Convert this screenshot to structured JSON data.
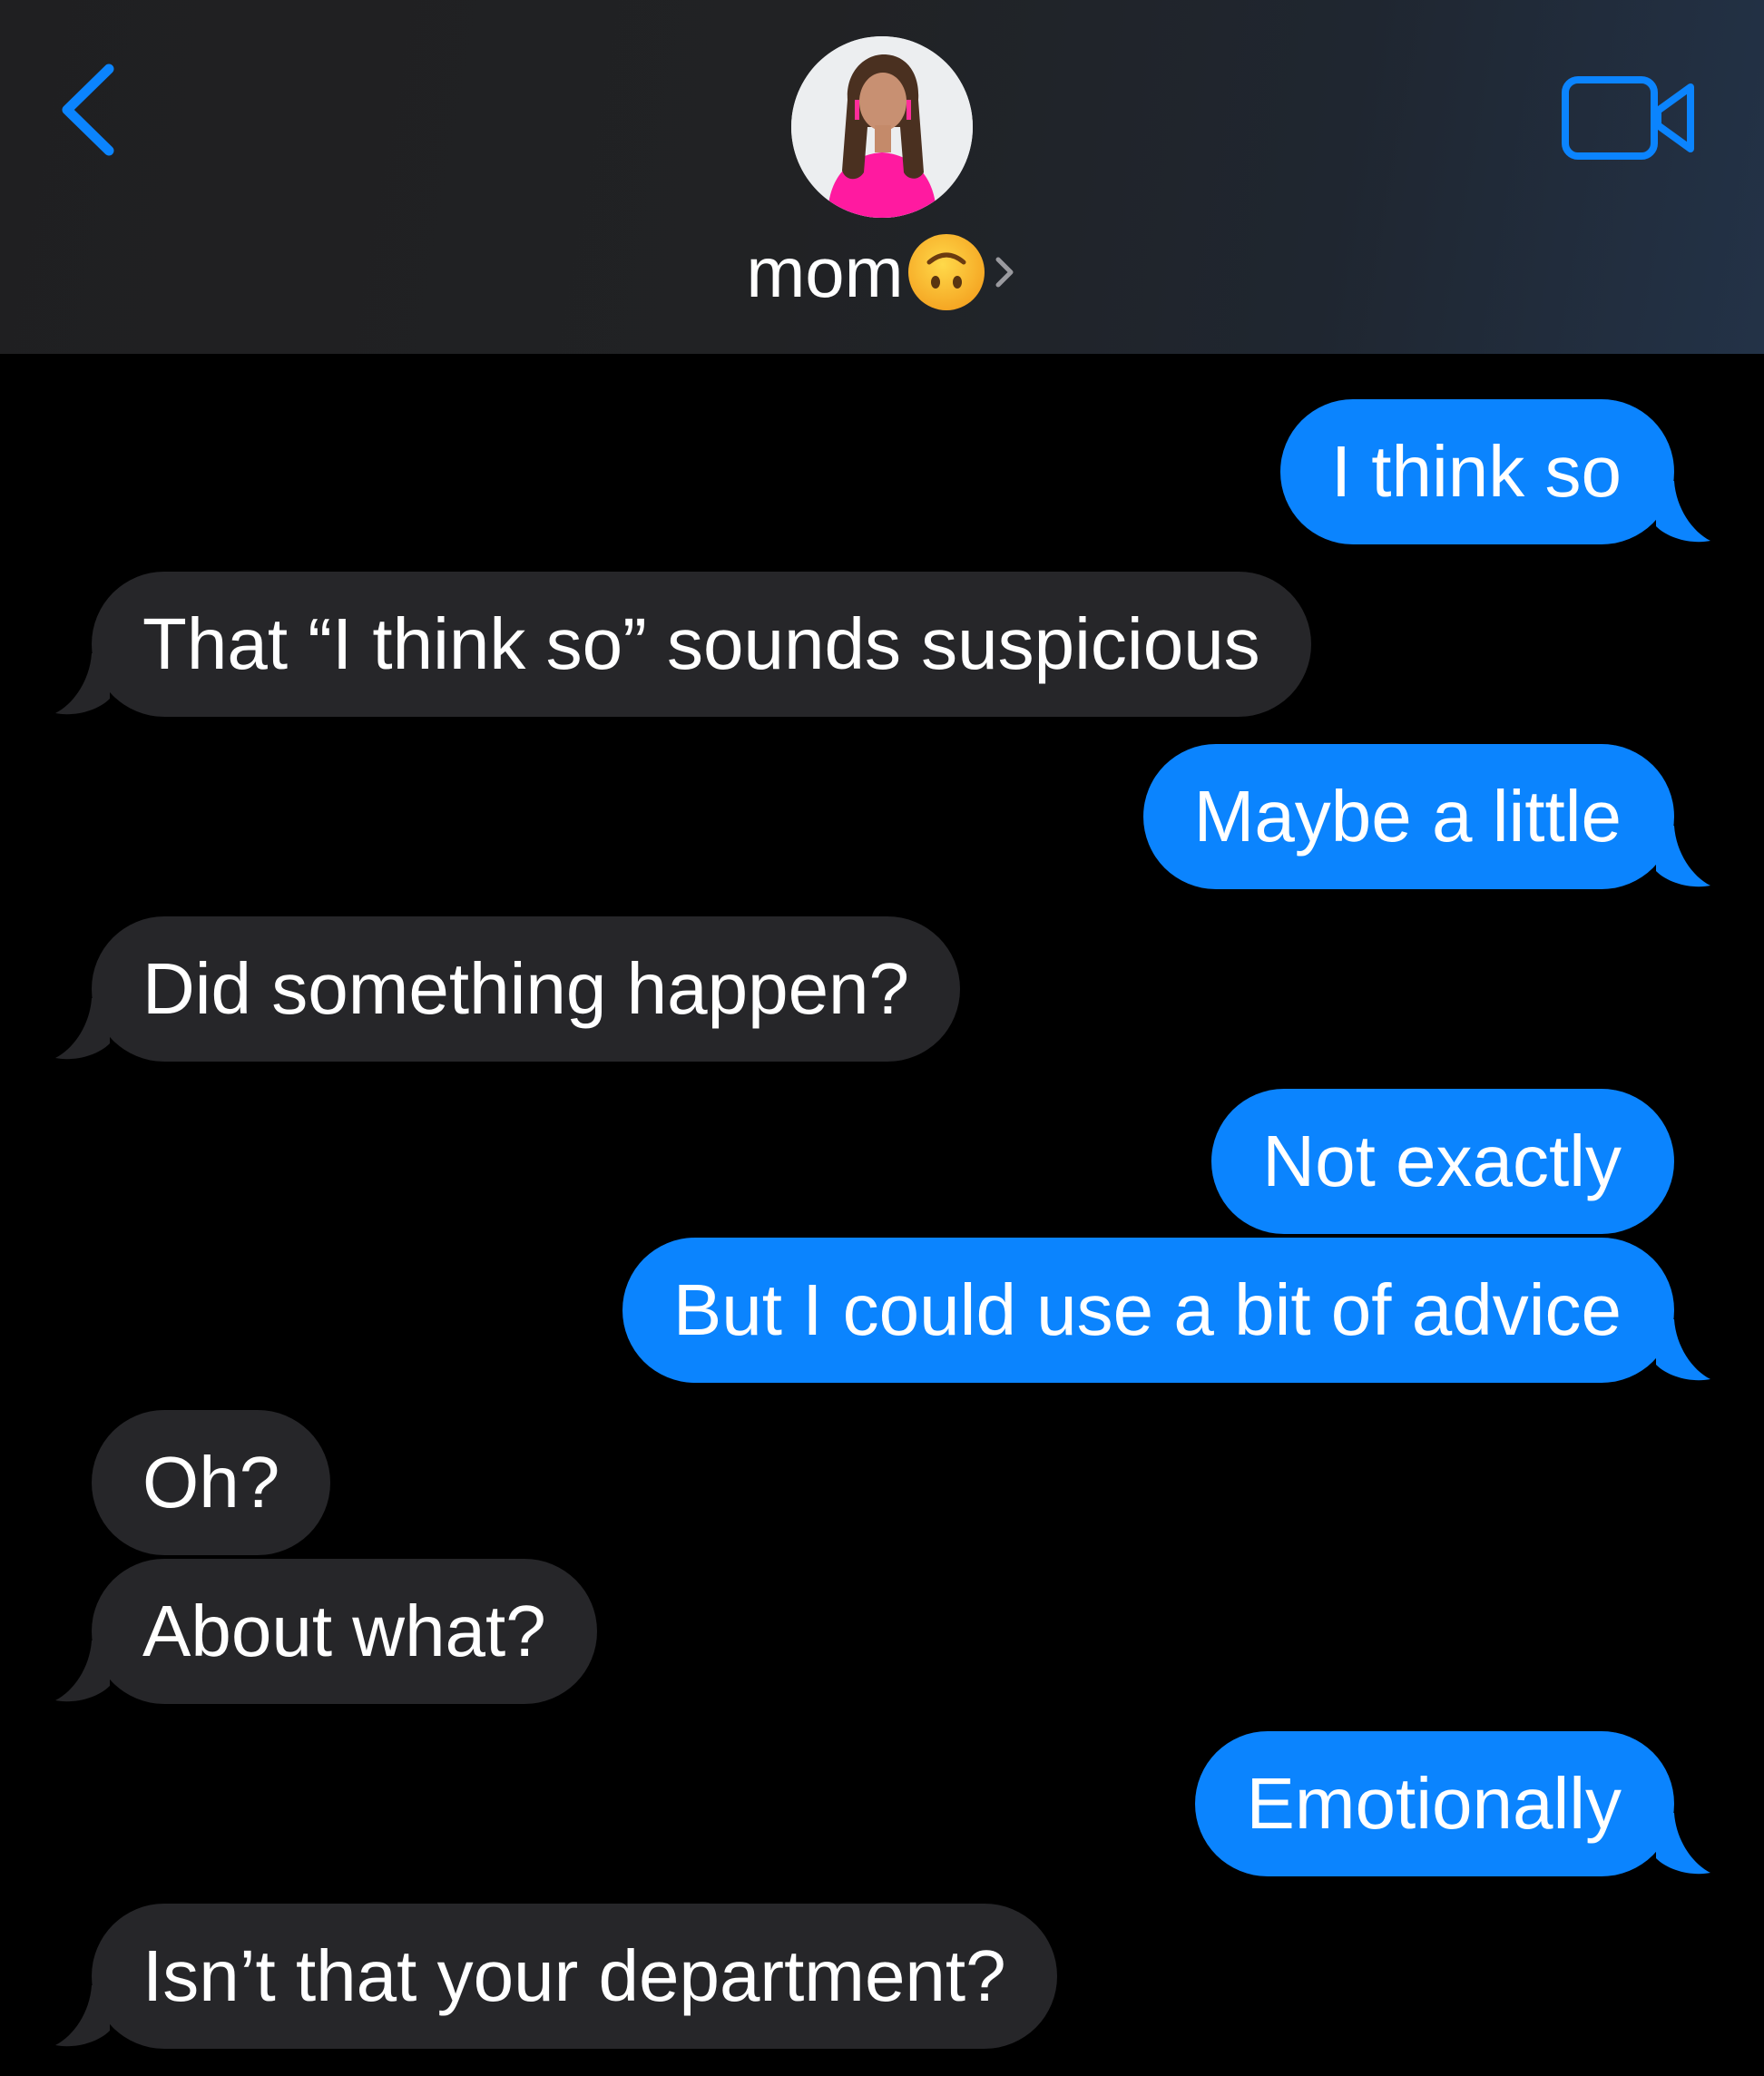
{
  "header": {
    "contact_name": "mom",
    "contact_emoji": "upside-down-face-emoji",
    "back_icon": "chevron-left-icon",
    "video_icon": "video-camera-icon",
    "accent_color": "#0b84fe"
  },
  "messages": [
    {
      "direction": "outgoing",
      "text": "I think so"
    },
    {
      "direction": "incoming",
      "text": "That “I think so” sounds suspicious"
    },
    {
      "direction": "outgoing",
      "text": "Maybe a little"
    },
    {
      "direction": "incoming",
      "text": "Did something happen?"
    },
    {
      "direction": "outgoing",
      "text": "Not exactly"
    },
    {
      "direction": "outgoing",
      "text": "But I could use a bit of advice"
    },
    {
      "direction": "incoming",
      "text": "Oh?"
    },
    {
      "direction": "incoming",
      "text": "About what?"
    },
    {
      "direction": "outgoing",
      "text": "Emotionally"
    },
    {
      "direction": "incoming",
      "text": "Isn’t that your department?"
    }
  ]
}
